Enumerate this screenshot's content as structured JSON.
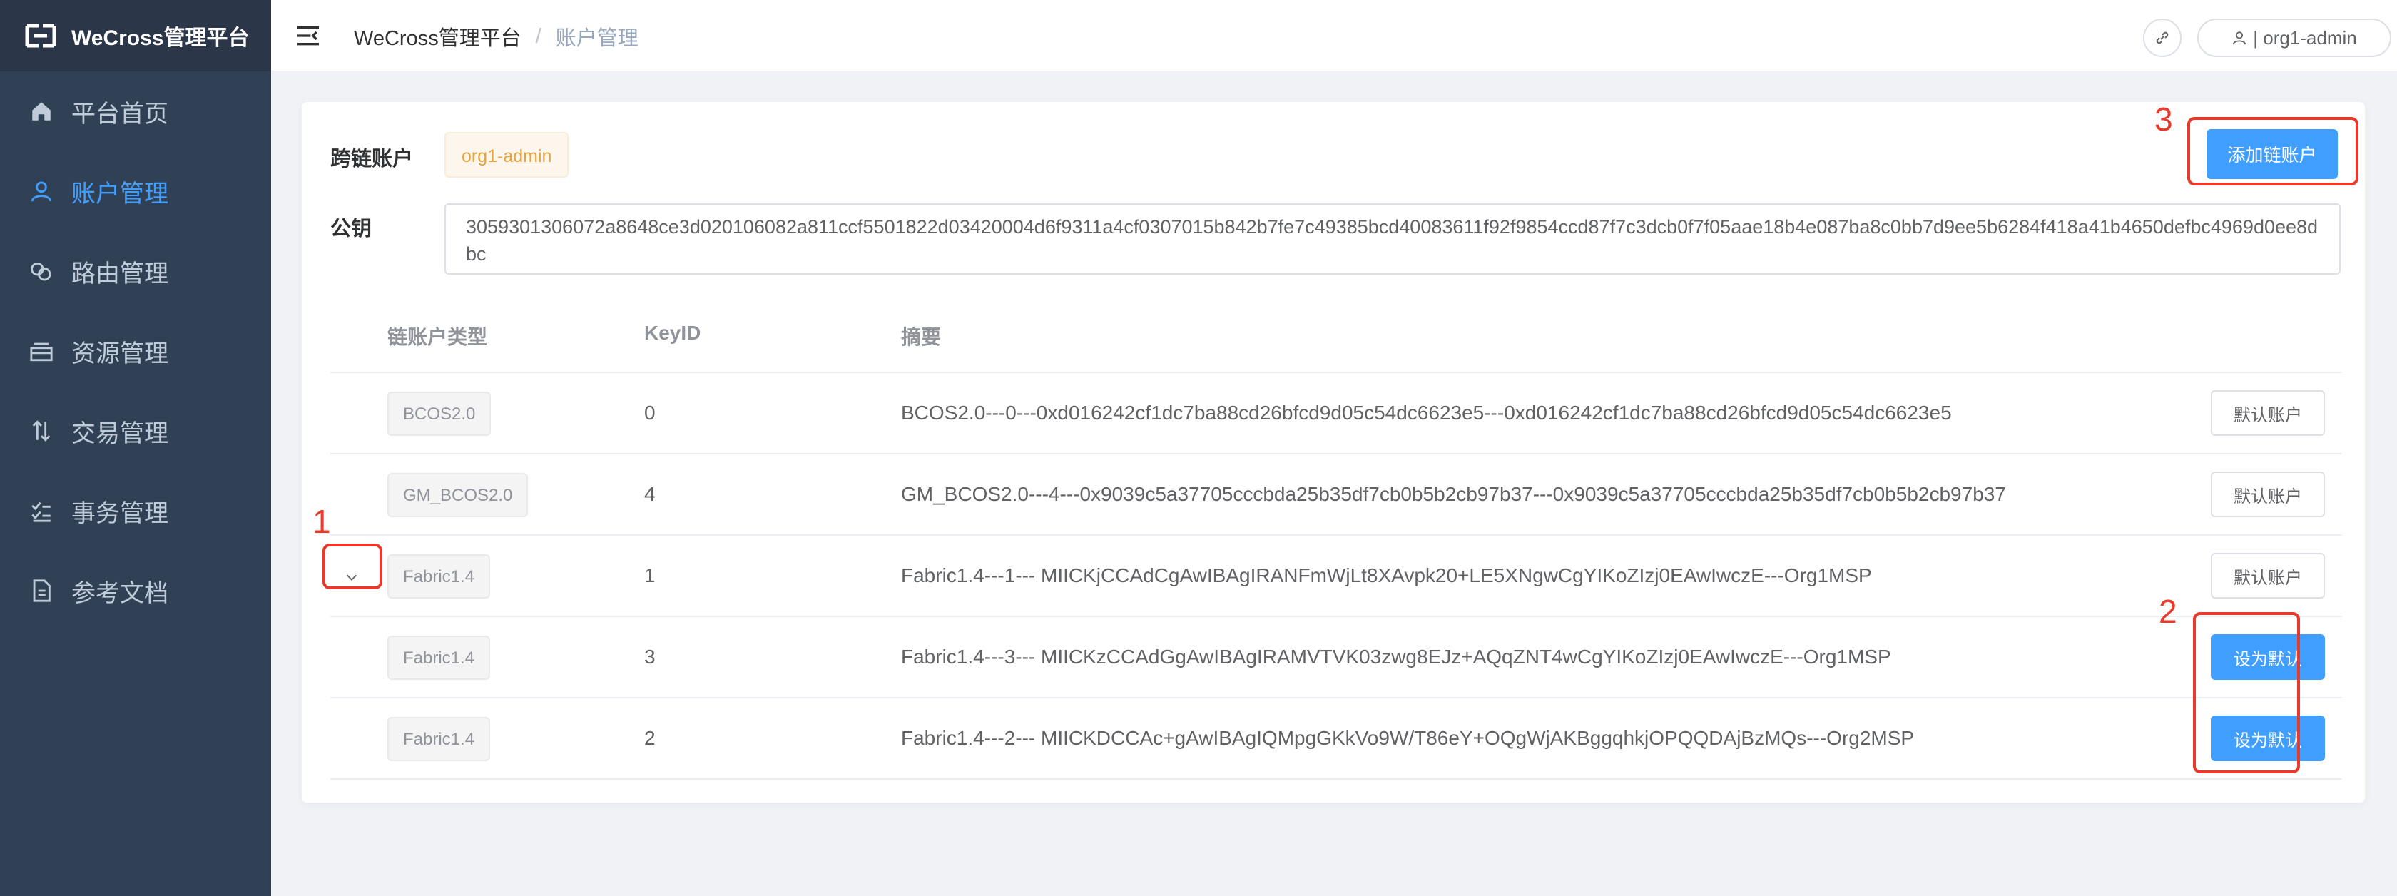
{
  "app": {
    "title": "WeCross管理平台"
  },
  "sidebar": {
    "items": [
      {
        "label": "平台首页",
        "icon": "home-icon"
      },
      {
        "label": "账户管理",
        "icon": "user-icon",
        "active": true
      },
      {
        "label": "路由管理",
        "icon": "route-icon"
      },
      {
        "label": "资源管理",
        "icon": "resource-icon"
      },
      {
        "label": "交易管理",
        "icon": "transaction-icon"
      },
      {
        "label": "事务管理",
        "icon": "task-icon"
      },
      {
        "label": "参考文档",
        "icon": "document-icon"
      }
    ]
  },
  "header": {
    "breadcrumb": {
      "home": "WeCross管理平台",
      "separator": "/",
      "current": "账户管理"
    },
    "user_label": "| org1-admin"
  },
  "card": {
    "account_label": "跨链账户",
    "account_value": "org1-admin",
    "add_button": "添加链账户",
    "pubkey_label": "公钥",
    "pubkey_value": "3059301306072a8648ce3d020106082a811ccf5501822d03420004d6f9311a4cf0307015b842b7fe7c49385bcd40083611f92f9854ccd87f7c3dcb0f7f05aae18b4e087ba8c0bb7d9ee5b6284f418a41b4650defbc4969d0ee8dbc"
  },
  "table": {
    "headers": [
      "链账户类型",
      "KeyID",
      "摘要"
    ],
    "rows": [
      {
        "type": "BCOS2.0",
        "keyid": "0",
        "digest": "BCOS2.0---0---0xd016242cf1dc7ba88cd26bfcd9d05c54dc6623e5---0xd016242cf1dc7ba88cd26bfcd9d05c54dc6623e5",
        "action": "默认账户"
      },
      {
        "type": "GM_BCOS2.0",
        "keyid": "4",
        "digest": "GM_BCOS2.0---4---0x9039c5a37705cccbda25b35df7cb0b5b2cb97b37---0x9039c5a37705cccbda25b35df7cb0b5b2cb97b37",
        "action": "默认账户"
      },
      {
        "type": "Fabric1.4",
        "keyid": "1",
        "digest": "Fabric1.4---1--- MIICKjCCAdCgAwIBAgIRANFmWjLt8XAvpk20+LE5XNgwCgYIKoZIzj0EAwIwczE---Org1MSP",
        "action": "默认账户"
      },
      {
        "type": "Fabric1.4",
        "keyid": "3",
        "digest": "Fabric1.4---3--- MIICKzCCAdGgAwIBAgIRAMVTVK03zwg8EJz+AQqZNT4wCgYIKoZIzj0EAwIwczE---Org1MSP",
        "action": "设为默认"
      },
      {
        "type": "Fabric1.4",
        "keyid": "2",
        "digest": "Fabric1.4---2--- MIICKDCCAc+gAwIBAgIQMpgGKkVo9W/T86eY+OQgWjAKBggqhkjOPQQDAjBzMQs---Org2MSP",
        "action": "设为默认"
      }
    ]
  },
  "annotations": {
    "one": "1",
    "two": "2",
    "three": "3"
  },
  "colors": {
    "accent": "#409eff",
    "sidebar_bg": "#304156",
    "annotation": "#e8392a"
  }
}
